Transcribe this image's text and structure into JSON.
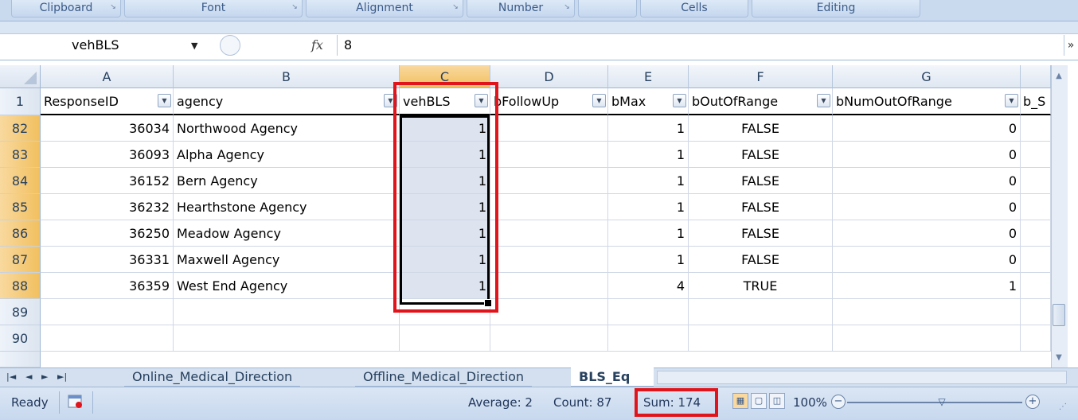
{
  "ribbon": {
    "groups": [
      {
        "label": "Clipboard"
      },
      {
        "label": "Font"
      },
      {
        "label": "Alignment"
      },
      {
        "label": "Number"
      },
      {
        "label": ""
      },
      {
        "label": "Cells"
      },
      {
        "label": "Editing"
      }
    ]
  },
  "formula_bar": {
    "name_box": "vehBLS",
    "fx_symbol": "fx",
    "value": "8",
    "expand_glyph": "»"
  },
  "columns": [
    {
      "letter": "A",
      "header": "ResponseID",
      "filter": true
    },
    {
      "letter": "B",
      "header": "agency",
      "filter": true
    },
    {
      "letter": "C",
      "header": "vehBLS",
      "filter": true
    },
    {
      "letter": "D",
      "header": "bFollowUp",
      "filter": true
    },
    {
      "letter": "E",
      "header": "bMax",
      "filter": true
    },
    {
      "letter": "F",
      "header": "bOutOfRange",
      "filter": true
    },
    {
      "letter": "G",
      "header": "bNumOutOfRange",
      "filter": true
    },
    {
      "letter": "",
      "header": "b_S",
      "filter": false
    }
  ],
  "header_row_number": "1",
  "rows": [
    {
      "num": "82",
      "cells": [
        "36034",
        "Northwood Agency",
        "1",
        "",
        "1",
        "FALSE",
        "0"
      ]
    },
    {
      "num": "83",
      "cells": [
        "36093",
        "Alpha Agency",
        "1",
        "",
        "1",
        "FALSE",
        "0"
      ]
    },
    {
      "num": "84",
      "cells": [
        "36152",
        "Bern Agency",
        "1",
        "",
        "1",
        "FALSE",
        "0"
      ]
    },
    {
      "num": "85",
      "cells": [
        "36232",
        "Hearthstone Agency",
        "1",
        "",
        "1",
        "FALSE",
        "0"
      ]
    },
    {
      "num": "86",
      "cells": [
        "36250",
        "Meadow Agency",
        "1",
        "",
        "1",
        "FALSE",
        "0"
      ]
    },
    {
      "num": "87",
      "cells": [
        "36331",
        "Maxwell Agency",
        "1",
        "",
        "1",
        "FALSE",
        "0"
      ]
    },
    {
      "num": "88",
      "cells": [
        "36359",
        "West End Agency",
        "1",
        "",
        "4",
        "TRUE",
        "1"
      ]
    },
    {
      "num": "89",
      "cells": [
        "",
        "",
        "",
        "",
        "",
        "",
        ""
      ]
    },
    {
      "num": "90",
      "cells": [
        "",
        "",
        "",
        "",
        "",
        "",
        ""
      ]
    }
  ],
  "sheet_tabs": {
    "nav": [
      "|◄",
      "◄",
      "►",
      "►|"
    ],
    "tabs": [
      "Online_Medical_Direction",
      "Offline_Medical_Direction",
      "BLS_Eq"
    ],
    "active": "BLS_Eq"
  },
  "status_bar": {
    "ready": "Ready",
    "average": "Average: 2",
    "count": "Count: 87",
    "sum": "Sum: 174",
    "zoom": "100%"
  },
  "colors": {
    "highlight": "#e0141a",
    "selection_header": "#f1c05f",
    "selected_cells": "#dde3ef"
  }
}
